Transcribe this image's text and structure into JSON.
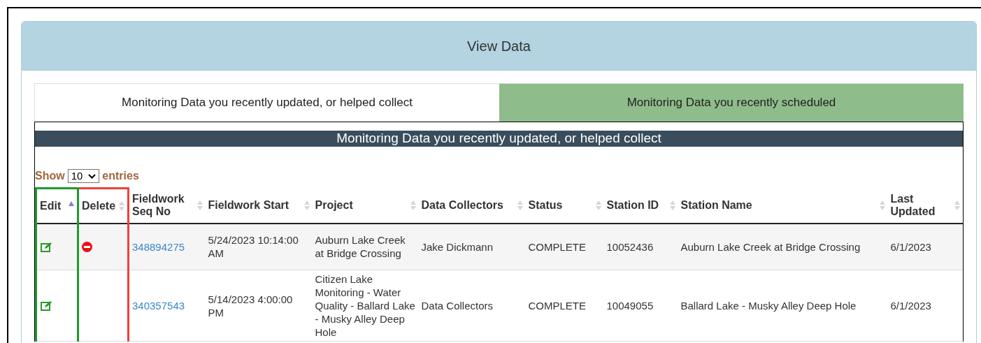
{
  "panel": {
    "title": "View Data"
  },
  "tabs": [
    {
      "label": "Monitoring Data you recently updated, or helped collect",
      "selected": true
    },
    {
      "label": "Monitoring Data you recently scheduled",
      "selected": false
    }
  ],
  "table_title": "Monitoring Data you recently updated, or helped collect",
  "length_menu": {
    "before": "Show",
    "value": "10",
    "after": "entries"
  },
  "columns": [
    {
      "label": "Edit",
      "sorted_ascending": true,
      "color": "#1f9a2e"
    },
    {
      "label": "Delete",
      "sorted_ascending": false,
      "color": "#f0403c"
    },
    {
      "label": "Fieldwork Seq No",
      "sorted_ascending": false
    },
    {
      "label": "Fieldwork Start",
      "sorted_ascending": false
    },
    {
      "label": "Project",
      "sorted_ascending": false
    },
    {
      "label": "Data Collectors",
      "sorted_ascending": false
    },
    {
      "label": "Status",
      "sorted_ascending": false
    },
    {
      "label": "Station ID",
      "sorted_ascending": false
    },
    {
      "label": "Station Name",
      "sorted_ascending": false
    },
    {
      "label": "Last Updated",
      "sorted_ascending": false
    }
  ],
  "rows": [
    {
      "can_delete": true,
      "seq_no": "348894275",
      "start": "5/24/2023 10:14:00 AM",
      "project": "Auburn Lake Creek at Bridge Crossing",
      "collectors": "Jake Dickmann",
      "status": "COMPLETE",
      "station_id": "10052436",
      "station_name": "Auburn Lake Creek at Bridge Crossing",
      "last_updated": "6/1/2023"
    },
    {
      "can_delete": false,
      "seq_no": "340357543",
      "start": "5/14/2023 4:00:00 PM",
      "project": "Citizen Lake Monitoring - Water Quality - Ballard Lake - Musky Alley Deep Hole",
      "collectors": "Data Collectors",
      "status": "COMPLETE",
      "station_id": "10049055",
      "station_name": "Ballard Lake - Musky Alley Deep Hole",
      "last_updated": "6/1/2023"
    }
  ]
}
